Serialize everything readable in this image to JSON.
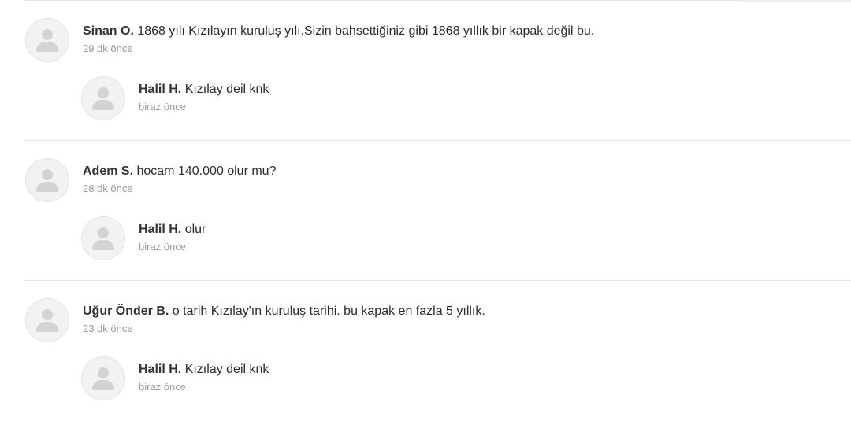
{
  "threads": [
    {
      "comment": {
        "author": "Sinan O.",
        "text": "1868 yılı Kızılayın kuruluş yılı.Sizin bahsettiğiniz gibi 1868 yıllık bir kapak değil bu.",
        "time": "29 dk önce"
      },
      "reply": {
        "author": "Halil H.",
        "text": "Kızılay deil knk",
        "time": "biraz önce"
      }
    },
    {
      "comment": {
        "author": "Adem S.",
        "text": "hocam 140.000 olur mu?",
        "time": "28 dk önce"
      },
      "reply": {
        "author": "Halil H.",
        "text": "olur",
        "time": "biraz önce"
      }
    },
    {
      "comment": {
        "author": "Uğur Önder B.",
        "text": "o tarih Kızılay'ın kuruluş tarihi. bu kapak en fazla 5 yıllık.",
        "time": "23 dk önce"
      },
      "reply": {
        "author": "Halil H.",
        "text": "Kızılay deil knk",
        "time": "biraz önce"
      }
    }
  ]
}
